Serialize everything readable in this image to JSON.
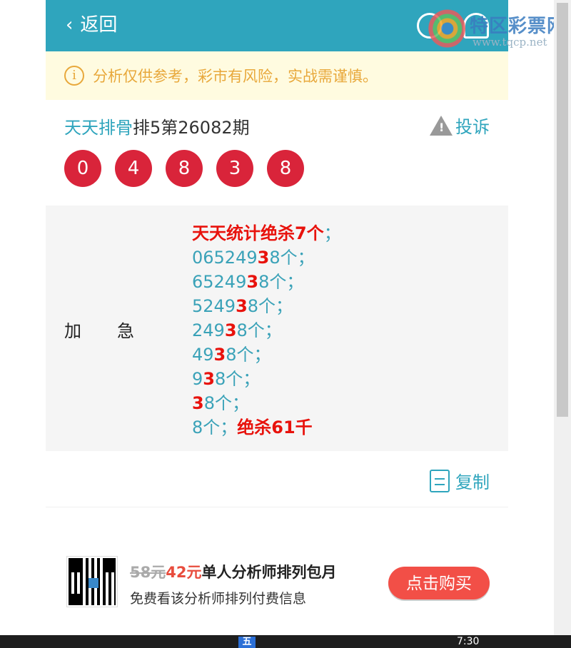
{
  "header": {
    "back_icon": "‹",
    "back_label": "返回",
    "logo_text": "特区彩票网",
    "logo_url": "www.tqcp.net"
  },
  "notice": {
    "icon": "i",
    "text": "分析仅供参考，彩市有风险，实战需谨慎。"
  },
  "issue": {
    "author": "天天排骨",
    "rest": "排5第26082期",
    "complain_label": "投诉"
  },
  "balls": [
    "0",
    "4",
    "8",
    "3",
    "8"
  ],
  "content": {
    "label": "加急",
    "headline": "天天统计绝杀7个",
    "headline_suffix": "；",
    "lines": [
      {
        "pre": "065249",
        "hit": "3",
        "post": "8个；"
      },
      {
        "pre": "65249",
        "hit": "3",
        "post": "8个；"
      },
      {
        "pre": "5249",
        "hit": "3",
        "post": "8个；"
      },
      {
        "pre": "249",
        "hit": "3",
        "post": "8个；"
      },
      {
        "pre": "49",
        "hit": "3",
        "post": "8个；"
      },
      {
        "pre": "9",
        "hit": "3",
        "post": "8个；"
      },
      {
        "pre": "",
        "hit": "3",
        "post": "8个；"
      }
    ],
    "last_line": "8个；",
    "last_kill": "绝杀61千"
  },
  "copy_label": "复制",
  "promo": {
    "old_price": "58元",
    "new_price": "42元",
    "title": "单人分析师排列包月",
    "subtitle": "免费看该分析师排列付费信息",
    "buy_label": "点击购买"
  },
  "taskbar": {
    "app_label": "五",
    "time": "7:30"
  },
  "colors": {
    "header": "#2fa5bd",
    "ball": "#d9243a",
    "highlight": "#e8120c",
    "buy": "#f24f47"
  }
}
